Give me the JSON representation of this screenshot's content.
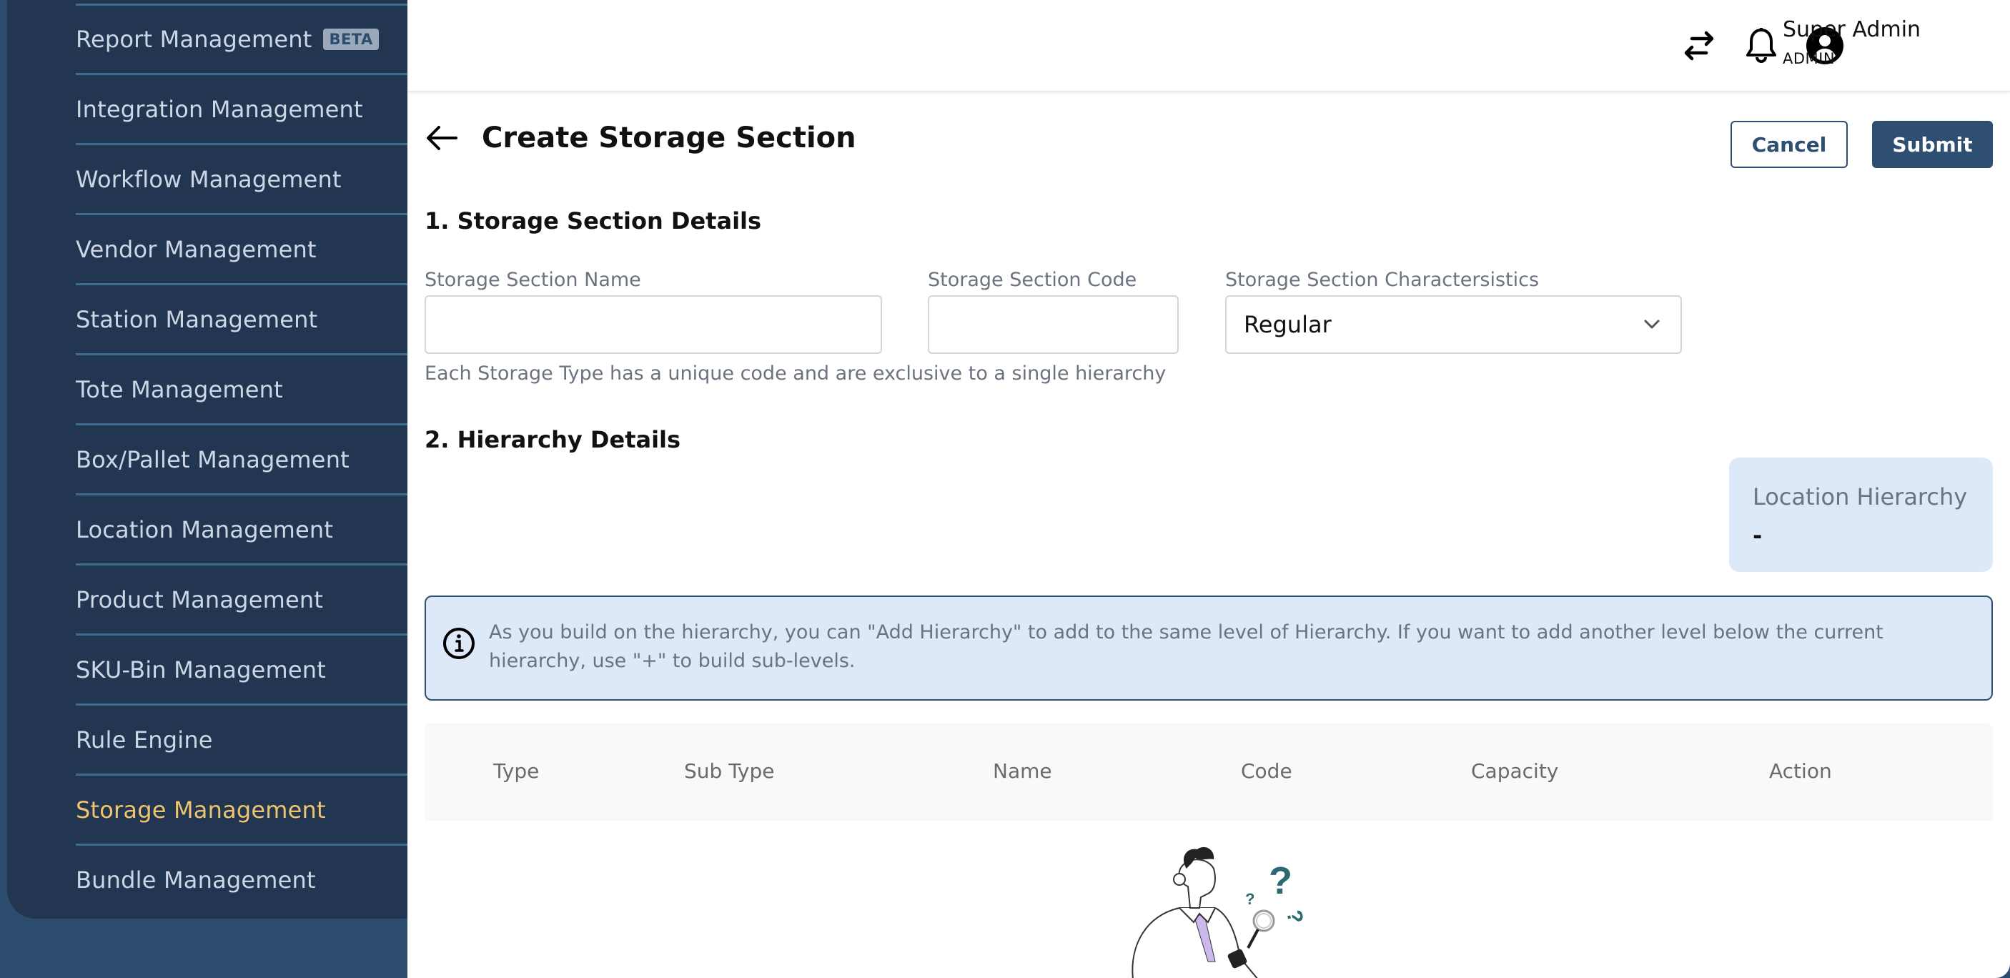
{
  "sidebar": {
    "items": [
      {
        "label": "Report Management",
        "badge": "BETA",
        "active": false
      },
      {
        "label": "Integration Management",
        "active": false
      },
      {
        "label": "Workflow Management",
        "active": false
      },
      {
        "label": "Vendor Management",
        "active": false
      },
      {
        "label": "Station Management",
        "active": false
      },
      {
        "label": "Tote Management",
        "active": false
      },
      {
        "label": "Box/Pallet Management",
        "active": false
      },
      {
        "label": "Location Management",
        "active": false
      },
      {
        "label": "Product Management",
        "active": false
      },
      {
        "label": "SKU-Bin Management",
        "active": false
      },
      {
        "label": "Rule Engine",
        "active": false
      },
      {
        "label": "Storage Management",
        "active": true
      },
      {
        "label": "Bundle Management",
        "active": false
      }
    ]
  },
  "header": {
    "icons": [
      "swap-arrows-icon",
      "bell-icon",
      "user-circle-icon"
    ],
    "user_name": "Super Admin",
    "user_role": "ADMIN"
  },
  "page": {
    "title": "Create Storage Section",
    "cancel_label": "Cancel",
    "submit_label": "Submit"
  },
  "section1": {
    "title": "1. Storage Section Details",
    "name_label": "Storage Section Name",
    "name_value": "",
    "code_label": "Storage Section Code",
    "code_value": "",
    "characteristics_label": "Storage Section Charactersistics",
    "characteristics_value": "Regular",
    "help_text": "Each Storage Type has a unique code and are exclusive to a single hierarchy"
  },
  "section2": {
    "title": "2. Hierarchy Details",
    "location_hierarchy_label": "Location Hierarchy",
    "location_hierarchy_value": "-",
    "info_text": "As you build on the hierarchy, you can \"Add Hierarchy\" to add to the same level of Hierarchy. If you want to add another level below the current hierarchy, use \"+\" to build sub-levels.",
    "table_columns": [
      "Type",
      "Sub Type",
      "Name",
      "Code",
      "Capacity",
      "Action"
    ]
  },
  "colors": {
    "sidebar_bg": "#233651",
    "sidebar_outer": "#2c4d6e",
    "active_nav": "#eec470",
    "primary": "#2f4f72",
    "info_bg": "#dde8f9"
  }
}
